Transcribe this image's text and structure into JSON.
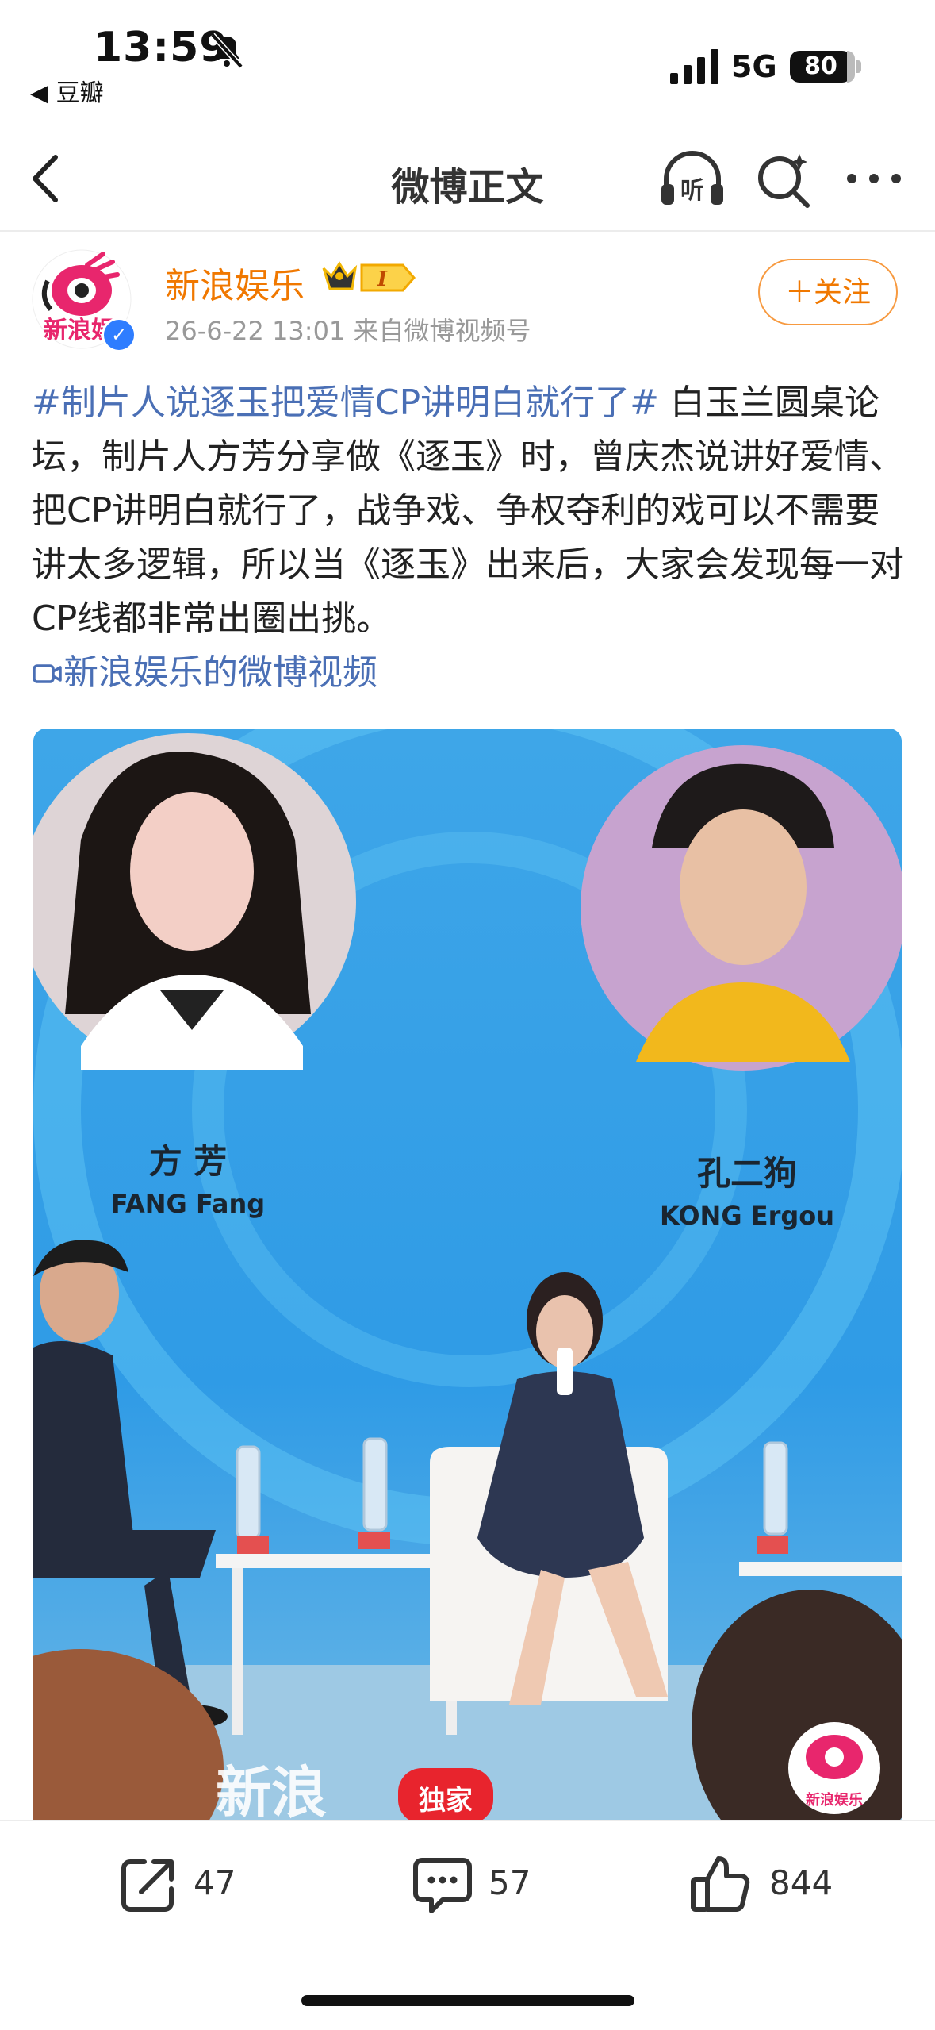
{
  "status_bar": {
    "time": "13:59",
    "back_app": "◀ 豆瓣",
    "network": "5G",
    "battery": "80"
  },
  "nav": {
    "title": "微博正文",
    "listen_label": "听"
  },
  "author": {
    "name": "新浪娱乐",
    "avatar_text": "新浪娱",
    "vip_level": "I",
    "meta": "26-6-22 13:01  来自微博视频号",
    "follow_label": "＋关注"
  },
  "post": {
    "hashtag": "#制片人说逐玉把爱情CP讲明白就行了#",
    "body": " 白玉兰圆桌论坛，制片人方芳分享做《逐玉》时，曾庆杰说讲好爱情、把CP讲明白就行了，战争戏、争权夺利的戏可以不需要讲太多逻辑，所以当《逐玉》出来后，大家会发现每一对CP线都非常出圈出挑。",
    "video_link": "新浪娱乐的微博视频"
  },
  "video": {
    "left_name_cn": "方 芳",
    "left_name_en": "FANG Fang",
    "right_name_cn": "孔二狗",
    "right_name_en": "KONG Ergou",
    "watermark_logo": "新浪",
    "watermark_badge": "独家",
    "corner_logo": "新浪娱乐"
  },
  "actions": {
    "share_count": "47",
    "comment_count": "57",
    "like_count": "844"
  },
  "colors": {
    "orange": "#f07800",
    "link_blue": "#4a6fb5",
    "verified_blue": "#2e7dff"
  }
}
